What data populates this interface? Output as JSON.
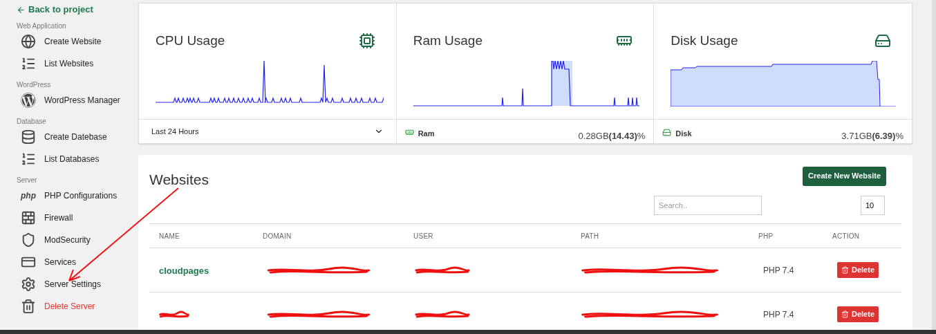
{
  "sidebar": {
    "back_link": "Back to project",
    "sections": [
      {
        "title": "Web Application",
        "items": [
          {
            "label": "Create Website",
            "kind": "normal"
          },
          {
            "label": "List Websites",
            "kind": "normal"
          }
        ]
      },
      {
        "title": "WordPress",
        "items": [
          {
            "label": "WordPress Manager",
            "kind": "normal"
          }
        ]
      },
      {
        "title": "Database",
        "items": [
          {
            "label": "Create Datebase",
            "kind": "normal"
          },
          {
            "label": "List Databases",
            "kind": "normal"
          }
        ]
      },
      {
        "title": "Server",
        "items": [
          {
            "label": "PHP Configurations",
            "badge": "php",
            "kind": "normal"
          },
          {
            "label": "Firewall",
            "kind": "normal"
          },
          {
            "label": "ModSecurity",
            "kind": "normal"
          },
          {
            "label": "Services",
            "kind": "normal"
          },
          {
            "label": "Server Settings",
            "kind": "normal"
          },
          {
            "label": "Delete Server",
            "kind": "danger"
          }
        ]
      }
    ]
  },
  "stats": {
    "cards": [
      {
        "title": "CPU Usage"
      },
      {
        "title": "Ram Usage"
      },
      {
        "title": "Disk Usage"
      }
    ],
    "range": "Last 24 Hours",
    "meters": [
      {
        "label": "Ram",
        "reading": "0.28GB**(14.43)**%"
      },
      {
        "label": "Disk",
        "reading": "3.71GB**(6.39)**%"
      }
    ]
  },
  "websites": {
    "title": "Websites",
    "create_button": "Create New Website",
    "search": {
      "placeholder": "Search.."
    },
    "page_size": "10",
    "columns": [
      "NAME",
      "DOMAIN",
      "USER",
      "PATH",
      "PHP",
      "ACTION"
    ],
    "rows": [
      {
        "name": "cloudpages",
        "php": "PHP 7.4",
        "action": "Delete"
      },
      {
        "php": "PHP 7.4",
        "action": "Delete"
      }
    ]
  },
  "annotation": {
    "kind": "arrow"
  }
}
